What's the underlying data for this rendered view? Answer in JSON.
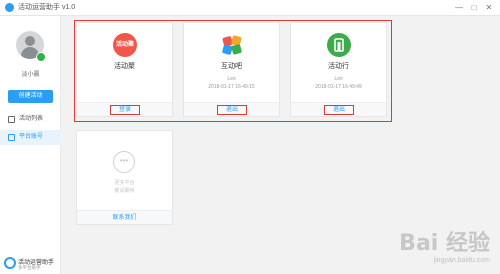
{
  "window": {
    "title": "活动运营助手 v1.0",
    "controls": [
      "—",
      "□",
      "✕"
    ]
  },
  "sidebar": {
    "username": "淡小晨",
    "create_button": "创建活动",
    "nav": [
      {
        "label": "活动列表",
        "icon": "list-icon",
        "active": false
      },
      {
        "label": "平台账号",
        "icon": "account-icon",
        "active": true
      }
    ],
    "brand_name": "活动运营助手",
    "brand_sub": "多平台助手"
  },
  "platforms": [
    {
      "name": "活动聚",
      "logo_text": "活动聚",
      "logo_color": "#f0574a",
      "user": "",
      "time": "",
      "action": "登录"
    },
    {
      "name": "互动吧",
      "logo_text": "",
      "logo_color": "#ffffff",
      "user": "Leo",
      "time": "2018-01-17 16:49:15",
      "action": "退出"
    },
    {
      "name": "活动行",
      "logo_text": "",
      "logo_color": "#3cab4a",
      "user": "Leo",
      "time": "2018-01-17 16:49:49",
      "action": "退出"
    }
  ],
  "placeholder_card": {
    "icon": "•••",
    "line1": "更多平台",
    "line2": "敬请期待",
    "link": "联系我们"
  },
  "watermark": {
    "brand": "Bai 经验",
    "url": "jingyan.baidu.com"
  }
}
